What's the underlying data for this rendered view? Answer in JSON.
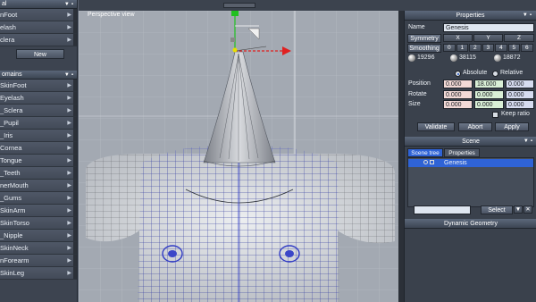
{
  "left_panel": {
    "top_section": {
      "header_visible": "al",
      "items": [
        "nFoot",
        "elash",
        "clera"
      ],
      "new_label": "New"
    },
    "domains_section": {
      "header_visible": "omains",
      "items": [
        "SkinFoot",
        "Eyelash",
        "_Sclera",
        "_Pupil",
        "_Iris",
        "Cornea",
        "Tongue",
        "_Teeth",
        "nerMouth",
        "_Gums",
        "SkinArm",
        "SkinTorso",
        "_Nipple",
        "SkinNeck",
        "nForearm",
        "SkinLeg"
      ]
    }
  },
  "viewport": {
    "title": "Perspective view"
  },
  "properties": {
    "title": "Properties",
    "name_label": "Name",
    "name_value": "Genesis",
    "symmetry_label": "Symmetry",
    "symmetry_axes": [
      "X",
      "Y",
      "Z"
    ],
    "smoothing_label": "Smoothing",
    "smoothing_levels": [
      "0",
      "1",
      "2",
      "3",
      "4",
      "5",
      "6"
    ],
    "counts": [
      "19296",
      "38115",
      "18872"
    ],
    "absolute_label": "Absolute",
    "relative_label": "Relative",
    "position_label": "Position",
    "position_values": [
      "0.000",
      "18.000",
      "0.000"
    ],
    "rotate_label": "Rotate",
    "rotate_values": [
      "0.000",
      "0.000",
      "0.000"
    ],
    "size_label": "Size",
    "size_values": [
      "0.000",
      "0.000",
      "0.000"
    ],
    "keep_ratio_label": "Keep ratio",
    "validate_label": "Validate",
    "abort_label": "Abort",
    "apply_label": "Apply"
  },
  "scene": {
    "title": "Scene",
    "tabs": [
      "Scene tree",
      "Properties"
    ],
    "tree_item": "Genesis",
    "select_label": "Select"
  },
  "dynamic_geometry": {
    "title": "Dynamic Geometry"
  },
  "colors": {
    "selection": "#2f63d6",
    "mesh_wire": "#3340c8",
    "gizmo_x": "#e02020",
    "gizmo_y": "#20c020",
    "gizmo_center": "#e8e000"
  }
}
